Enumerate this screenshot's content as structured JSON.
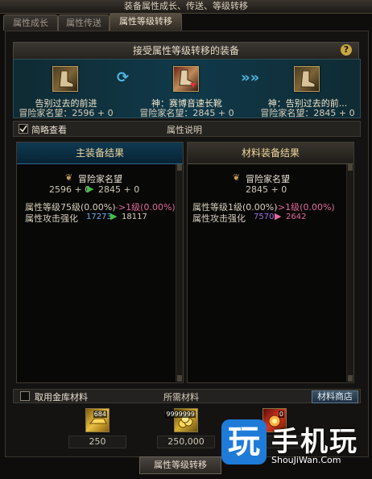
{
  "window_title": "装备属性成长、传送、等级转移",
  "tabs": [
    {
      "label": "属性成长",
      "active": false
    },
    {
      "label": "属性传送",
      "active": false
    },
    {
      "label": "属性等级转移",
      "active": true
    }
  ],
  "header": {
    "title": "接受属性等级转移的装备",
    "help": "?"
  },
  "transfer": {
    "left": {
      "name": "告别过去的前进",
      "stat": "冒险家名望：2596 + 0"
    },
    "middle": {
      "name": "神：赛博音速长靴",
      "stat": "冒险家名望：2845 + 0"
    },
    "right": {
      "name": "神：告别过去的前...",
      "stat": "冒险家名望：2845 + 0"
    }
  },
  "options": {
    "brief_view_label": "简略查看",
    "brief_view_checked": true,
    "section_title": "属性说明"
  },
  "main_result": {
    "title": "主装备结果",
    "fame_label": "冒险家名望",
    "fame_from": "2596 + 0",
    "fame_to": "2845 + 0",
    "level_line_prefix": "属性等级75级(0.00%)",
    "level_line_suffix": "->1级(0.00%)",
    "attack_label": "属性攻击强化",
    "attack_from": "17273",
    "attack_to": "18117"
  },
  "material_result": {
    "title": "材料装备结果",
    "fame_label": "冒险家名望",
    "fame_value": "2845 + 0",
    "level_line_prefix": "属性等级1级(0.00%)",
    "level_line_suffix": "->1级(0.00%)",
    "attack_label": "属性攻击强化",
    "attack_from": "7570",
    "attack_to": "2642"
  },
  "materials_bar": {
    "use_vault_label": "取用金库材料",
    "use_vault_checked": false,
    "required_label": "所需材料",
    "shop_button": "材料商店"
  },
  "materials": [
    {
      "icon": "gold-bar-icon",
      "count_badge": "684",
      "qty": "250"
    },
    {
      "icon": "gold-coins-icon",
      "count_badge": "9999999",
      "qty": "250,000"
    },
    {
      "icon": "red-orb-icon",
      "count_badge": "0",
      "qty": ""
    }
  ],
  "action_button": "属性等级转移",
  "watermark": {
    "logo": "玩",
    "text": "手机玩",
    "sub": "ShouJiWan.Com"
  },
  "colors": {
    "accent_blue": "#4fb7e0",
    "green_arrow": "#3fbf4a",
    "purple_value": "#a070e0",
    "pink_value": "#e06a9a"
  }
}
